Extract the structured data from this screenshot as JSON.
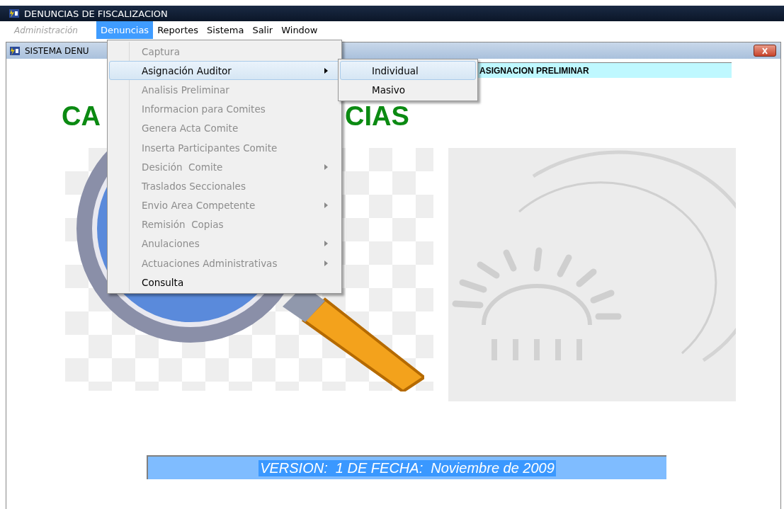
{
  "window": {
    "title": "DENUNCIAS DE FISCALIZACION"
  },
  "menu_bar": [
    {
      "label": "Administración",
      "disabled": true,
      "selected": false
    },
    {
      "label": "Denuncias",
      "disabled": false,
      "selected": true
    },
    {
      "label": "Reportes",
      "disabled": false,
      "selected": false
    },
    {
      "label": "Sistema",
      "disabled": false,
      "selected": false
    },
    {
      "label": "Salir",
      "disabled": false,
      "selected": false
    },
    {
      "label": "Window",
      "disabled": false,
      "selected": false
    }
  ],
  "child_window": {
    "title": "SISTEMA DENU"
  },
  "status_field": {
    "value": "ASIGNACION PRELIMINAR"
  },
  "heading": [
    "CA",
    "CIAS"
  ],
  "version_field": {
    "value": "VERSION:  1 DE FECHA:  Noviembre de 2009"
  },
  "dropdown": [
    {
      "label": "Captura",
      "disabled": true,
      "submenu": false,
      "selected": false
    },
    {
      "label": "Asignación Auditor",
      "disabled": false,
      "submenu": true,
      "selected": true
    },
    {
      "label": "Analisis Preliminar",
      "disabled": true,
      "submenu": false,
      "selected": false
    },
    {
      "label": "Informacion para Comites",
      "disabled": true,
      "submenu": false,
      "selected": false
    },
    {
      "label": "Genera Acta Comite",
      "disabled": true,
      "submenu": false,
      "selected": false
    },
    {
      "label": "Inserta Participantes Comite",
      "disabled": true,
      "submenu": false,
      "selected": false
    },
    {
      "label": "Desición  Comite",
      "disabled": true,
      "submenu": true,
      "selected": false
    },
    {
      "label": "Traslados Seccionales",
      "disabled": true,
      "submenu": false,
      "selected": false
    },
    {
      "label": "Envio Area Competente",
      "disabled": true,
      "submenu": true,
      "selected": false
    },
    {
      "label": "Remisión  Copias",
      "disabled": true,
      "submenu": false,
      "selected": false
    },
    {
      "label": "Anulaciones",
      "disabled": true,
      "submenu": true,
      "selected": false
    },
    {
      "label": "Actuaciones Administrativas",
      "disabled": true,
      "submenu": true,
      "selected": false
    },
    {
      "label": "Consulta",
      "disabled": false,
      "submenu": false,
      "selected": false
    }
  ],
  "submenu": [
    {
      "label": "Individual",
      "selected": true
    },
    {
      "label": "Masivo",
      "selected": false
    }
  ]
}
